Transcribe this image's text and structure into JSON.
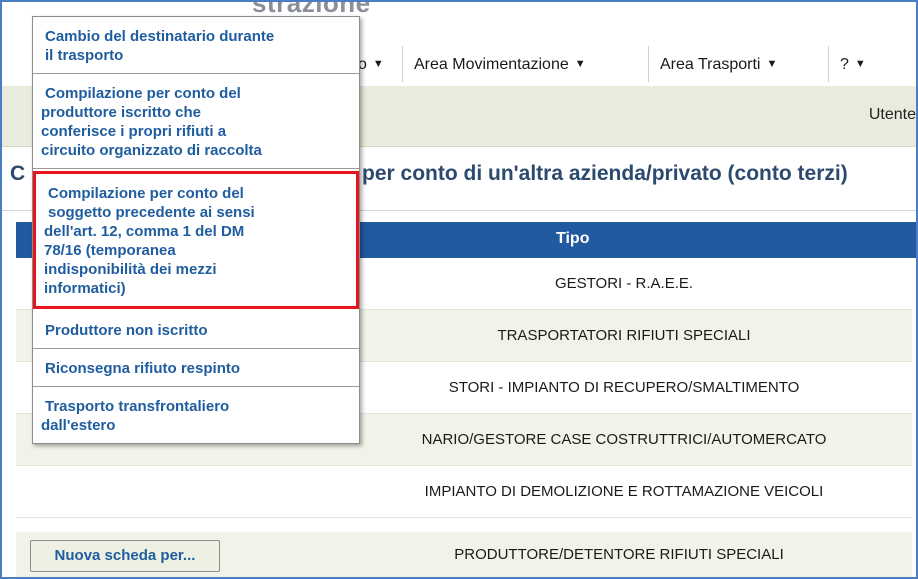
{
  "app": {
    "title_fragment": "strazione"
  },
  "menubar": {
    "items": [
      {
        "label": "o"
      },
      {
        "label": "Area Movimentazione"
      },
      {
        "label": "Area Trasporti"
      },
      {
        "label": "?"
      }
    ]
  },
  "userbar": {
    "user_label": "Utente"
  },
  "section": {
    "title_start": "C",
    "title_tail": "per conto di un'altra azienda/privato (conto terzi)"
  },
  "table": {
    "header": {
      "tipo": "Tipo"
    },
    "rows": [
      "GESTORI - R.A.E.E.",
      "TRASPORTATORI RIFIUTI SPECIALI",
      "STORI - IMPIANTO DI RECUPERO/SMALTIMENTO",
      "NARIO/GESTORE CASE COSTRUTTRICI/AUTOMERCATO",
      "IMPIANTO DI DEMOLIZIONE E ROTTAMAZIONE VEICOLI",
      "PRODUTTORE/DETENTORE RIFIUTI SPECIALI"
    ]
  },
  "dropdown": {
    "items": [
      {
        "line1": "Cambio del destinatario durante",
        "line2": "il trasporto"
      },
      {
        "lines": [
          "Compilazione per conto del",
          "produttore iscritto che",
          "conferisce i propri rifiuti a",
          "circuito organizzato di raccolta"
        ]
      },
      {
        "lines": [
          "Compilazione per conto del",
          "soggetto precedente ai sensi",
          "dell'art. 12, comma 1 del DM",
          "78/16 (temporanea",
          "indisponibilità  dei mezzi",
          "informatici)"
        ],
        "highlighted": true,
        "highlight_color": "#e8151c"
      },
      {
        "lines": [
          "Produttore non iscritto"
        ]
      },
      {
        "lines": [
          "Riconsegna rifiuto respinto"
        ]
      },
      {
        "lines": [
          "Trasporto transfrontaliero",
          "dall'estero"
        ]
      }
    ]
  },
  "button": {
    "new_label": "Nuova scheda per..."
  },
  "colors": {
    "accent_blue": "#225aa0",
    "link_blue": "#1f5d9f",
    "row_alt": "#f1f3e9",
    "highlight": "#e8151c"
  }
}
